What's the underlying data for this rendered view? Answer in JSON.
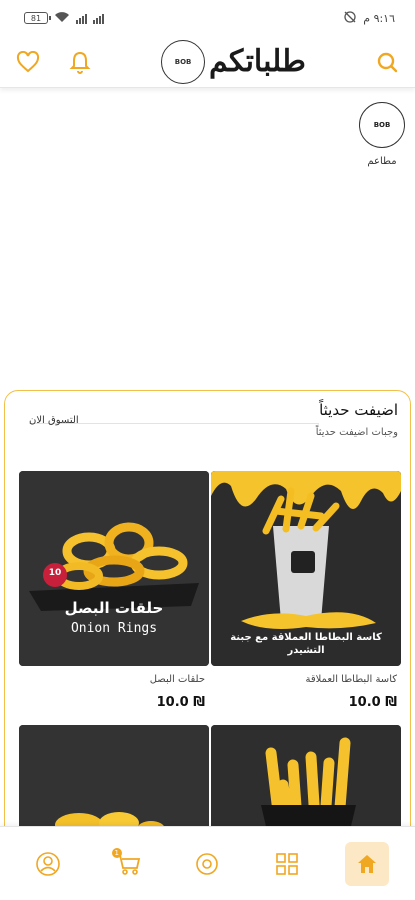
{
  "status_bar": {
    "battery": "81",
    "time": "٩:١٦ م"
  },
  "header": {
    "logo_text": "طلباتكم",
    "logo_badge": "BOB"
  },
  "restaurant": {
    "label": "مطاعم",
    "badge": "BOB"
  },
  "new_section": {
    "title": "اضيفت حديثاً",
    "subtitle": "وجبات اضيفت حديثاً",
    "shop_now": "التسوق الان",
    "items": [
      {
        "name": "حلقات البصل",
        "price": "10.0 ₪",
        "caption_ar": "حلقات البصل",
        "caption_en": "Onion Rings",
        "tag": "10"
      },
      {
        "name": "كاسة البطاطا العملاقة",
        "price": "10.0 ₪",
        "caption_ar": "كاسة البطاطا العملاقة مع جبنة التشيدر"
      },
      {
        "name": "",
        "price": ""
      },
      {
        "name": "",
        "price": ""
      }
    ]
  },
  "bottom_nav": {
    "cart_count": "1"
  },
  "colors": {
    "accent": "#f0a722",
    "border": "#f2c04a",
    "active_bg": "#fde8c6"
  }
}
